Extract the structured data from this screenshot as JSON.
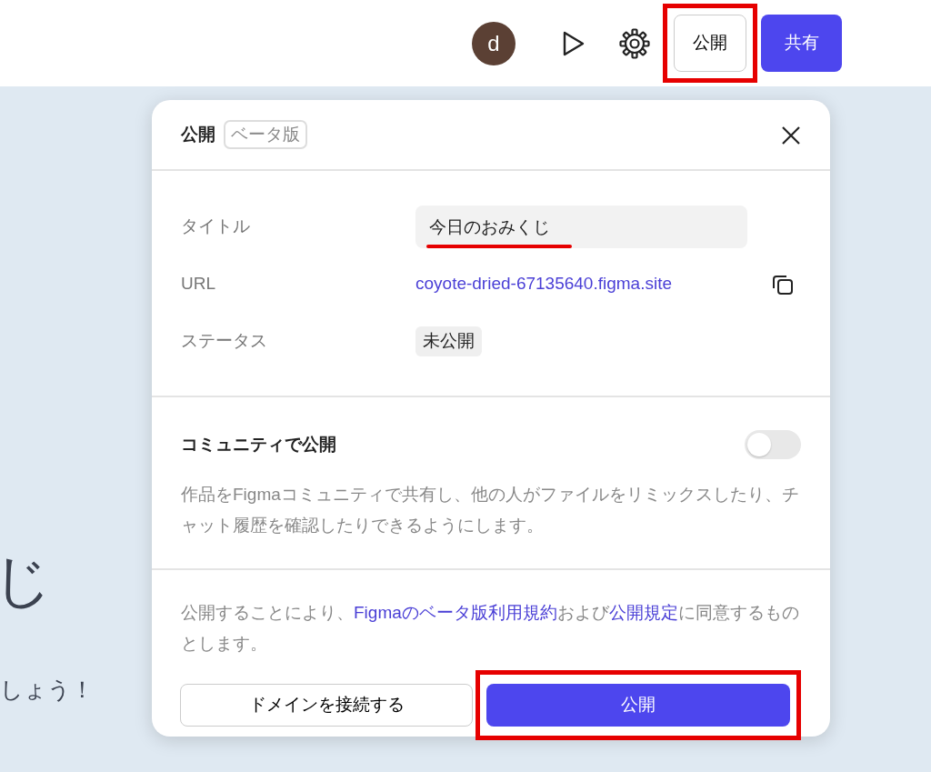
{
  "topbar": {
    "avatar": "d",
    "publish_button": {
      "label": "公開",
      "highlighted": true
    },
    "share_button": "共有"
  },
  "background_text": {
    "heading": "じ",
    "line": "しょう！"
  },
  "dialog": {
    "title": "公開",
    "badge": "ベータ版",
    "fields": [
      {
        "kind": "input",
        "label": "タイトル",
        "value": "今日のおみくじ",
        "underlined": true
      },
      {
        "kind": "link",
        "label": "URL",
        "value": "coyote-dried-67135640.figma.site"
      },
      {
        "kind": "status",
        "label": "ステータス",
        "value": "未公開"
      }
    ],
    "community": {
      "title": "コミュニティで公開",
      "on": false,
      "description": "作品をFigmaコミュニティで共有し、他の人がファイルをリミックスしたり、チャット履歴を確認したりできるようにします。"
    },
    "terms": {
      "parts": [
        {
          "kind": "text",
          "text": "公開することにより、"
        },
        {
          "kind": "link",
          "text": "Figmaのベータ版利用規約"
        },
        {
          "kind": "text",
          "text": "および"
        },
        {
          "kind": "link",
          "text": "公開規定"
        },
        {
          "kind": "text",
          "text": "に同意するものとします。"
        }
      ]
    },
    "domain_button": "ドメインを接続する",
    "publish_button": {
      "label": "公開",
      "highlighted": true
    }
  }
}
